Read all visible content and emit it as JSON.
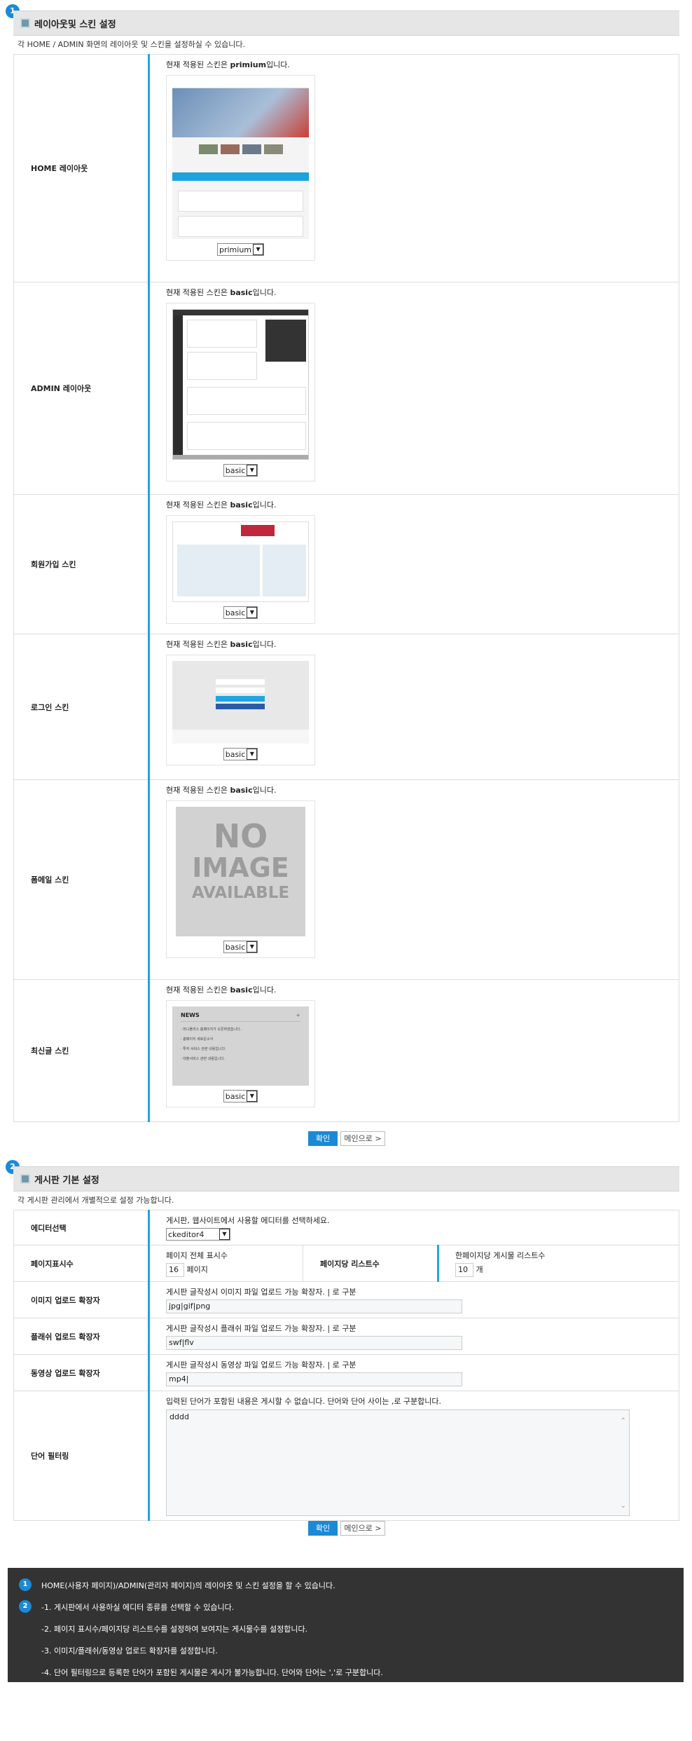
{
  "section1": {
    "badge": "1",
    "title": "레이아웃및 스킨 설정",
    "description": "각 HOME / ADMIN 화면의 레이아웃 및 스킨을 설정하실 수 있습니다.",
    "rows": [
      {
        "label": "HOME 레이아웃",
        "prefix": "현재 적용된 스킨은 ",
        "skin": "primium",
        "suffix": "입니다.",
        "select": "primium"
      },
      {
        "label": "ADMIN 레이아웃",
        "prefix": "현재 적용된 스킨은 ",
        "skin": "basic",
        "suffix": "입니다.",
        "select": "basic"
      },
      {
        "label": "회원가입 스킨",
        "prefix": "현재 적용된 스킨은 ",
        "skin": "basic",
        "suffix": "입니다.",
        "select": "basic"
      },
      {
        "label": "로그인 스킨",
        "prefix": "현재 적용된 스킨은 ",
        "skin": "basic",
        "suffix": "입니다.",
        "select": "basic"
      },
      {
        "label": "폼메일 스킨",
        "prefix": "현재 적용된 스킨은 ",
        "skin": "basic",
        "suffix": "입니다.",
        "select": "basic"
      },
      {
        "label": "최신글 스킨",
        "prefix": "현재 적용된 스킨은 ",
        "skin": "basic",
        "suffix": "입니다.",
        "select": "basic"
      }
    ],
    "noimage": [
      "NO",
      "IMAGE",
      "AVAILABLE"
    ],
    "news": {
      "title": "NEWS",
      "items": [
        "· 머니플러스 홈페이지가 오픈하였습니다.",
        "· 홈페이지 새로운소식",
        "· 투자 서비스 관련 내용입니다.",
        "· 대출서비스 관련 내용입니다."
      ]
    },
    "confirm": "확인",
    "main": "메인으로 >"
  },
  "section2": {
    "badge": "2",
    "title": "게시판 기본 설정",
    "description": "각 게시판 관리에서 개별적으로 설정 가능합니다.",
    "editor": {
      "label": "에디터선택",
      "help": "게시판, 웹사이트에서 사용할 에디터를 선택하세요.",
      "value": "ckeditor4"
    },
    "paging": {
      "label": "페이지표시수",
      "help": "페이지 전체 표시수",
      "value": "16",
      "unit": "페이지",
      "label2": "페이지당 리스트수",
      "help2": "한페이지당 게시물 리스트수",
      "value2": "10",
      "unit2": "개"
    },
    "image_ext": {
      "label": "이미지 업로드 확장자",
      "help": "게시판 글작성시 이미지 파일 업로드 가능 확장자. | 로 구분",
      "value": "jpg|gif|png"
    },
    "flash_ext": {
      "label": "플래쉬 업로드 확장자",
      "help": "게시판 글작성시 플래쉬 파일 업로드 가능 확장자. | 로 구분",
      "value": "swf|flv"
    },
    "video_ext": {
      "label": "동영상 업로드 확장자",
      "help": "게시판 글작성시 동영상 파일 업로드 가능 확장자. | 로 구분",
      "value": "mp4|"
    },
    "filter": {
      "label": "단어 필터링",
      "help": "입력된 단어가 포함된 내용은 게시할 수 없습니다. 단어와 단어 사이는 ,로 구분합니다.",
      "value": "dddd"
    },
    "confirm": "확인",
    "main": "메인으로 >"
  },
  "help": [
    {
      "badge": "1",
      "text": "HOME(사용자 페이지)/ADMIN(관리자 페이지)의 레이아웃 및 스킨 설정을 할 수 있습니다."
    },
    {
      "badge": "2",
      "text": "-1. 게시판에서 사용하실 에디터 종류를 선택할 수 있습니다."
    },
    {
      "badge": "",
      "text": "-2. 페이지 표시수/페이지당 리스트수를 설정하여 보여지는 게시물수를 설정합니다."
    },
    {
      "badge": "",
      "text": "-3. 이미지/플래쉬/동영상 업로드 확장자를 설정합니다."
    },
    {
      "badge": "",
      "text": "-4. 단어 필터링으로 등록한 단어가 포함된 게시물은 게시가 불가능합니다. 단어와 단어는 ','로 구분합니다."
    }
  ]
}
